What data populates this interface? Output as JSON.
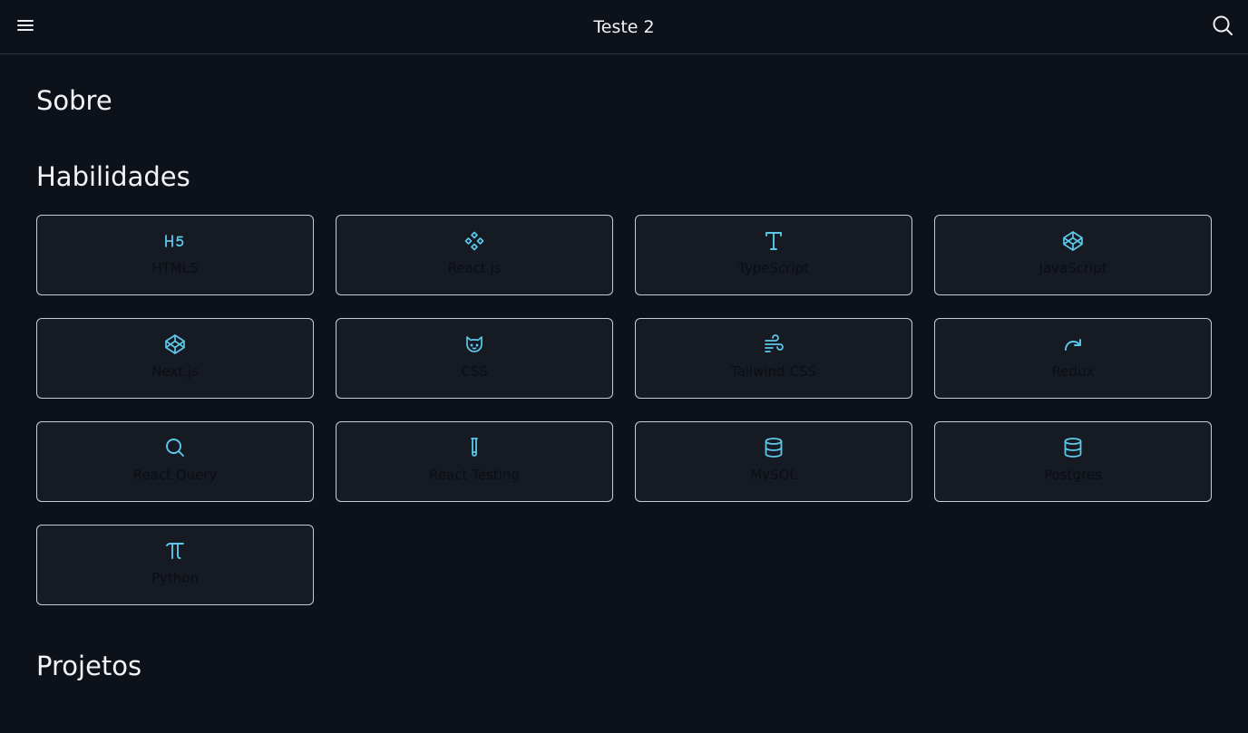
{
  "header": {
    "title": "Teste 2",
    "menu_icon": "hamburger-menu-icon",
    "search_icon": "search-icon"
  },
  "sections": {
    "about": "Sobre",
    "skills": "Habilidades",
    "projects": "Projetos"
  },
  "skills": [
    {
      "label": "HTML5",
      "icon": "html5-icon"
    },
    {
      "label": "React.js",
      "icon": "react-icon"
    },
    {
      "label": "TypeScript",
      "icon": "typescript-icon"
    },
    {
      "label": "JavaScript",
      "icon": "javascript-icon"
    },
    {
      "label": "Next.js",
      "icon": "nextjs-icon"
    },
    {
      "label": "CSS",
      "icon": "css-icon"
    },
    {
      "label": "Tailwind CSS",
      "icon": "tailwind-icon"
    },
    {
      "label": "Redux",
      "icon": "redux-icon"
    },
    {
      "label": "React Query",
      "icon": "react-query-icon"
    },
    {
      "label": "React Testing",
      "icon": "react-testing-icon"
    },
    {
      "label": "MySQL",
      "icon": "mysql-icon"
    },
    {
      "label": "Postgres",
      "icon": "postgres-icon"
    },
    {
      "label": "Python",
      "icon": "python-icon"
    }
  ],
  "colors": {
    "background": "#0d1119",
    "card_background": "#151a23",
    "card_border": "#c9cdd3",
    "icon_accent": "#5cc8ea",
    "label_text": "#0b0e14",
    "title_text": "#f3f4f6"
  }
}
